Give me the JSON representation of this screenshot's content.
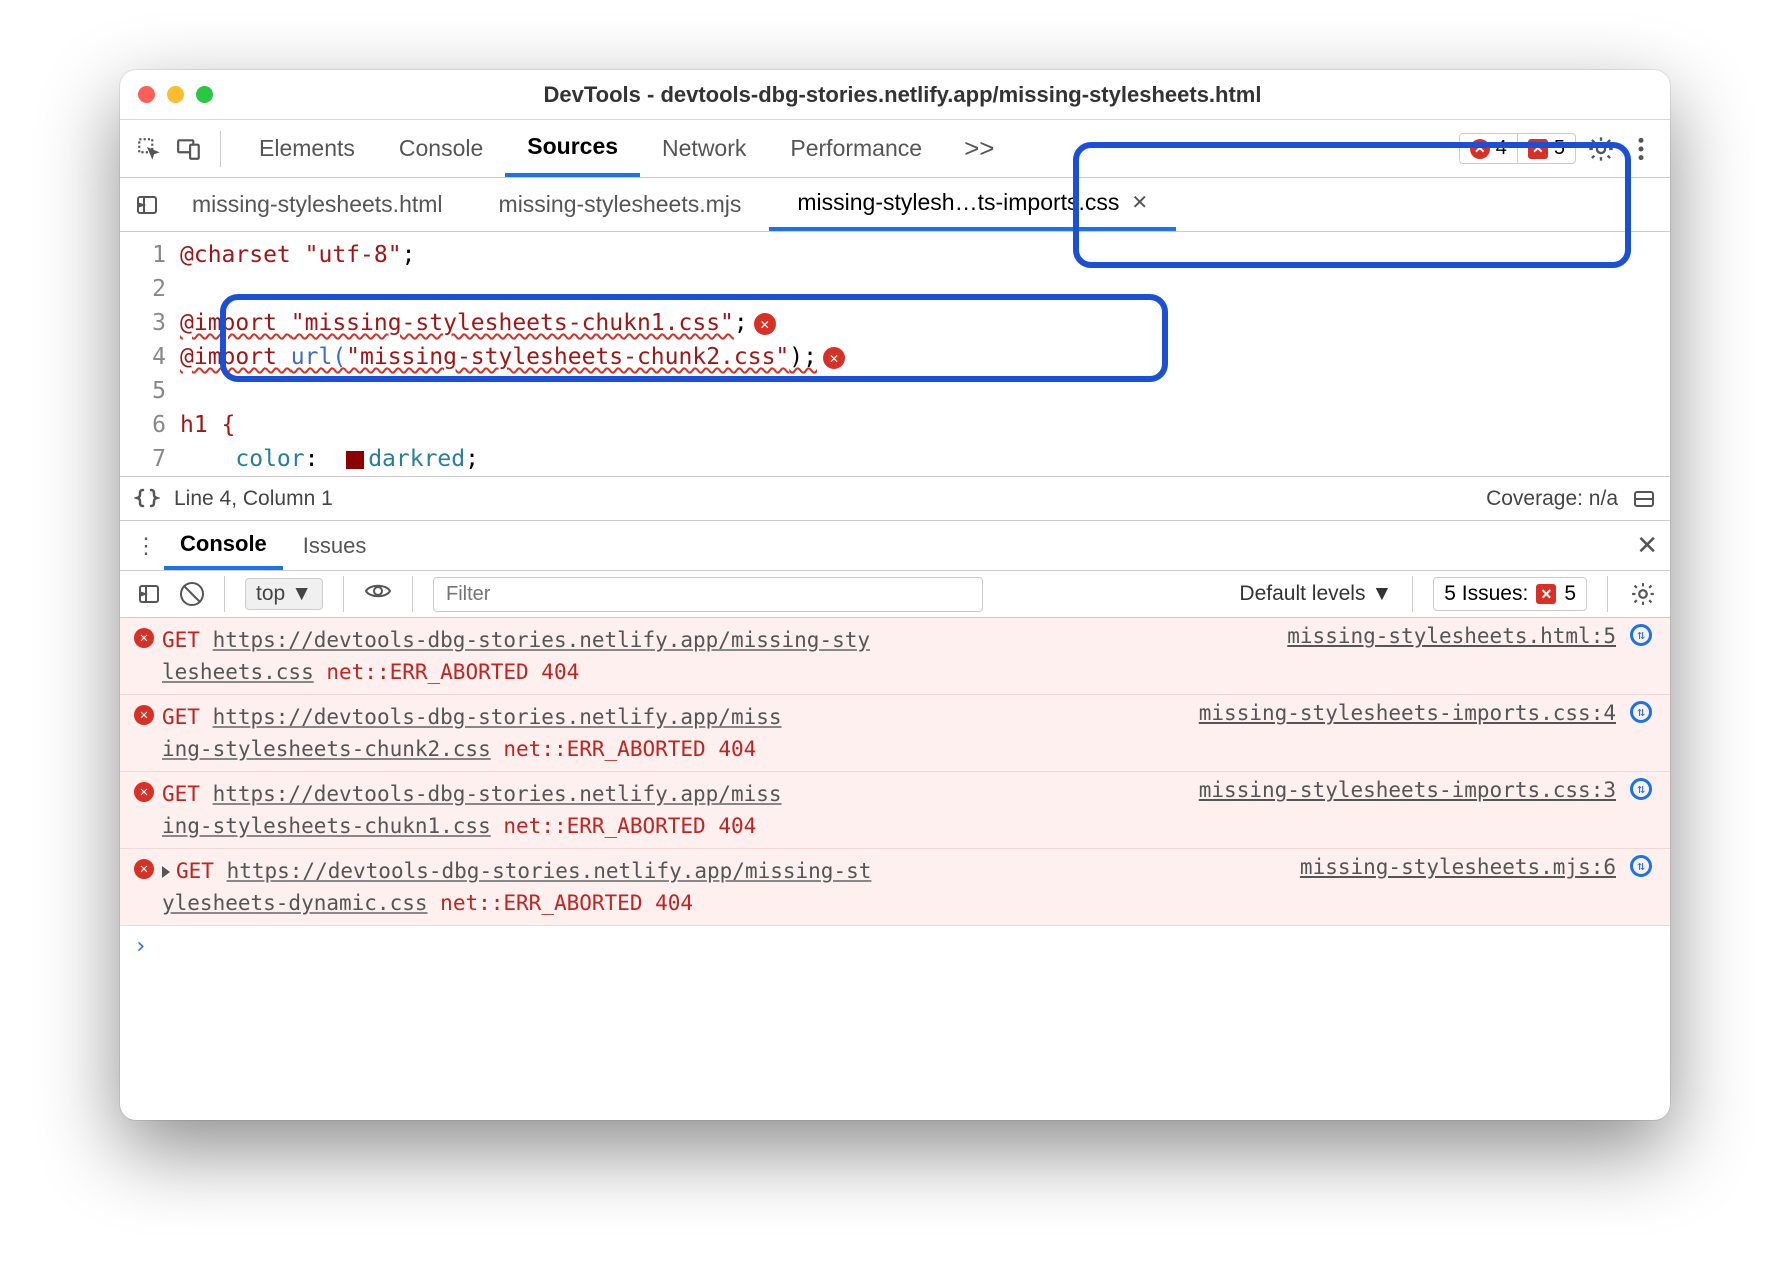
{
  "window": {
    "title": "DevTools - devtools-dbg-stories.netlify.app/missing-stylesheets.html"
  },
  "panels": {
    "tabs": [
      "Elements",
      "Console",
      "Sources",
      "Network",
      "Performance"
    ],
    "active": "Sources",
    "more": ">>"
  },
  "toolbar_badges": {
    "errors": "4",
    "issues": "5"
  },
  "file_tabs": {
    "items": [
      {
        "label": "missing-stylesheets.html"
      },
      {
        "label": "missing-stylesheets.mjs"
      },
      {
        "label": "missing-stylesh…ts-imports.css"
      }
    ],
    "active_index": 2
  },
  "editor": {
    "lines": [
      {
        "n": "1",
        "tokens": [
          {
            "t": "@charset ",
            "c": "at"
          },
          {
            "t": "\"utf-8\"",
            "c": "str"
          },
          {
            "t": ";",
            "c": ""
          }
        ]
      },
      {
        "n": "2",
        "tokens": []
      },
      {
        "n": "3",
        "tokens": [
          {
            "t": "@import ",
            "c": "at wavy"
          },
          {
            "t": "\"missing-stylesheets-chukn1.css\"",
            "c": "str wavy"
          },
          {
            "t": ";",
            "c": ""
          }
        ],
        "error": true
      },
      {
        "n": "4",
        "tokens": [
          {
            "t": "@import ",
            "c": "at wavy"
          },
          {
            "t": "url(",
            "c": "kw wavy"
          },
          {
            "t": "\"missing-stylesheets-chunk2.css\"",
            "c": "str wavy"
          },
          {
            "t": ");",
            "c": "wavy"
          }
        ],
        "error": true
      },
      {
        "n": "5",
        "tokens": []
      },
      {
        "n": "6",
        "tokens": [
          {
            "t": "h1 {",
            "c": "sel"
          }
        ]
      },
      {
        "n": "7",
        "tokens": [
          {
            "t": "    ",
            "c": ""
          },
          {
            "t": "color",
            "c": "val"
          },
          {
            "t": ":  ",
            "c": ""
          },
          {
            "t": "[SW]",
            "c": "swatch"
          },
          {
            "t": "darkred",
            "c": "val"
          },
          {
            "t": ";",
            "c": ""
          }
        ]
      }
    ]
  },
  "statusbar": {
    "pos": "Line 4, Column 1",
    "coverage": "Coverage: n/a"
  },
  "drawer": {
    "tabs": [
      "Console",
      "Issues"
    ],
    "active": "Console"
  },
  "console_toolbar": {
    "context": "top",
    "filter_placeholder": "Filter",
    "levels": "Default levels",
    "issues_label": "5 Issues:",
    "issues_count": "5"
  },
  "console_messages": [
    {
      "prefix": "GET ",
      "url_wrap1": "https://devtools-dbg-stories.netlify.app/missing-sty",
      "url_wrap2": "lesheets.css",
      "code": "net::ERR_ABORTED 404",
      "source": "missing-stylesheets.html:5",
      "expandable": false
    },
    {
      "prefix": "GET ",
      "url_wrap1": "https://devtools-dbg-stories.netlify.app/miss",
      "url_wrap2": "ing-stylesheets-chunk2.css",
      "code": "net::ERR_ABORTED 404",
      "source": "missing-stylesheets-imports.css:4",
      "expandable": false
    },
    {
      "prefix": "GET ",
      "url_wrap1": "https://devtools-dbg-stories.netlify.app/miss",
      "url_wrap2": "ing-stylesheets-chukn1.css",
      "code": "net::ERR_ABORTED 404",
      "source": "missing-stylesheets-imports.css:3",
      "expandable": false
    },
    {
      "prefix": "GET ",
      "url_wrap1": "https://devtools-dbg-stories.netlify.app/missing-st",
      "url_wrap2": "ylesheets-dynamic.css",
      "code": "net::ERR_ABORTED 404",
      "source": "missing-stylesheets.mjs:6",
      "expandable": true
    }
  ]
}
